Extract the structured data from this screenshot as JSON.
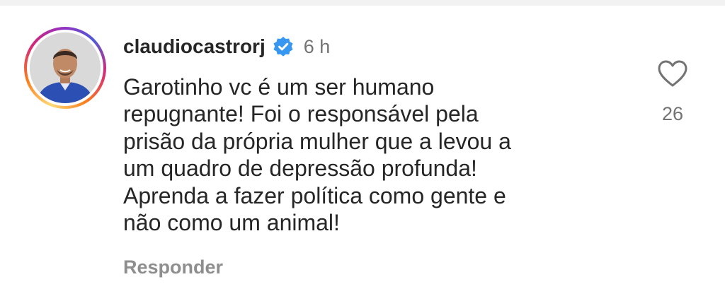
{
  "comment": {
    "username": "claudiocastrorj",
    "verified_icon": "verified-badge-icon",
    "time": "6 h",
    "text_lines": [
      "Garotinho vc é um ser humano",
      "repugnante! Foi o responsável pela",
      "prisão da própria mulher que a levou a",
      "um quadro de depressão profunda!",
      "Aprenda a fazer política como gente e",
      "não como um animal!"
    ],
    "reply_label": "Responder",
    "like_icon": "heart-icon",
    "like_count": "26"
  },
  "colors": {
    "verified_blue": "#3897f0",
    "text": "#262626",
    "secondary": "#737373",
    "reply": "#8e8e8e"
  }
}
